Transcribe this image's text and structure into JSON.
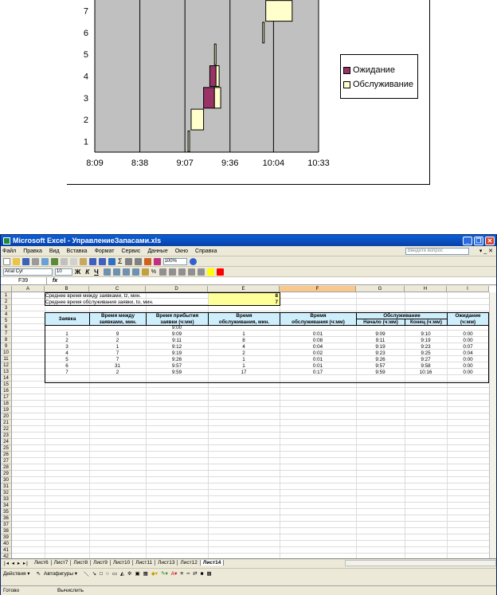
{
  "chart_data": {
    "type": "bar",
    "subtype": "stacked-horizontal-gantt",
    "x_tick_labels": [
      "8:09",
      "8:38",
      "9:07",
      "9:36",
      "10:04",
      "10:33"
    ],
    "y_tick_labels": [
      "1",
      "2",
      "3",
      "4",
      "5",
      "6",
      "7"
    ],
    "xlim": [
      "8:09",
      "10:33"
    ],
    "ylim": [
      0.5,
      7.5
    ],
    "categories": [
      1,
      2,
      3,
      4,
      5,
      6,
      7
    ],
    "series": [
      {
        "name": "Ожидание",
        "color": "#993366",
        "start": [
          "9:09",
          "9:11",
          "9:19",
          "9:23",
          "9:26",
          "9:57",
          "9:59"
        ],
        "duration_min": [
          0,
          0,
          7,
          4,
          0,
          0,
          0
        ]
      },
      {
        "name": "Обслуживание",
        "color": "#ffffcc",
        "start": [
          "9:09",
          "9:11",
          "9:19",
          "9:23",
          "9:26",
          "9:57",
          "9:59"
        ],
        "duration_min": [
          1,
          8,
          4,
          2,
          1,
          1,
          17
        ]
      }
    ],
    "grid": true,
    "plot_background": "#c0c0c0",
    "legend_position": "right"
  },
  "excel": {
    "title": "Microsoft Excel - УправлениеЗапасами.xls",
    "menu": [
      "Файл",
      "Правка",
      "Вид",
      "Вставка",
      "Формат",
      "Сервис",
      "Данные",
      "Окно",
      "Справка"
    ],
    "ask_placeholder": "Введите вопрос",
    "font_name": "Arial Cyr",
    "font_size": "10",
    "zoom": "100%",
    "name_box": "F39",
    "fx": "fx",
    "columns": [
      "A",
      "B",
      "C",
      "D",
      "E",
      "F",
      "G",
      "H",
      "I"
    ],
    "selected_column": "F",
    "params": {
      "tz_label": "Среднее время между заявками, tz, мин.",
      "tz_value": "8",
      "to_label": "Среднее время обслуживания заявки, to, мин.",
      "to_value": "7"
    },
    "headers": {
      "req": "Заявка",
      "interval_1": "Время между",
      "interval_2": "заявками, мин.",
      "arrival_1": "Время прибытия",
      "arrival_2": "заявки (ч:мм)",
      "svc_min_1": "Время",
      "svc_min_2": "обслуживания, мин.",
      "svc_hm_1": "Время",
      "svc_hm_2": "обслуживания (ч:мм)",
      "service_group": "Обслуживание",
      "start": "Начало (ч:мм)",
      "end": "Конец (ч:мм)",
      "wait_1": "Ожидание",
      "wait_2": "(ч:мм)"
    },
    "row7_arrival": "9:00",
    "rows": [
      {
        "n": "1",
        "dt": "9",
        "arr": "9:09",
        "svc": "1",
        "svc_hm": "0:01",
        "start": "9:09",
        "end": "9:10",
        "wait": "0:00"
      },
      {
        "n": "2",
        "dt": "2",
        "arr": "9:11",
        "svc": "8",
        "svc_hm": "0:08",
        "start": "9:11",
        "end": "9:19",
        "wait": "0:00"
      },
      {
        "n": "3",
        "dt": "1",
        "arr": "9:12",
        "svc": "4",
        "svc_hm": "0:04",
        "start": "9:19",
        "end": "9:23",
        "wait": "0:07"
      },
      {
        "n": "4",
        "dt": "7",
        "arr": "9:19",
        "svc": "2",
        "svc_hm": "0:02",
        "start": "9:23",
        "end": "9:25",
        "wait": "0:04"
      },
      {
        "n": "5",
        "dt": "7",
        "arr": "9:26",
        "svc": "1",
        "svc_hm": "0:01",
        "start": "9:26",
        "end": "9:27",
        "wait": "0:00"
      },
      {
        "n": "6",
        "dt": "31",
        "arr": "9:57",
        "svc": "1",
        "svc_hm": "0:01",
        "start": "9:57",
        "end": "9:58",
        "wait": "0:00"
      },
      {
        "n": "7",
        "dt": "2",
        "arr": "9:59",
        "svc": "17",
        "svc_hm": "0:17",
        "start": "9:59",
        "end": "10:16",
        "wait": "0:00"
      }
    ],
    "sheet_tabs": [
      "Лист6",
      "Лист7",
      "Лист8",
      "Лист9",
      "Лист10",
      "Лист11",
      "Лист13",
      "Лист12",
      "Лист14"
    ],
    "active_tab": "Лист14",
    "draw_actions": "Действия ▾",
    "autoshapes": "Автофигуры ▾",
    "status_ready": "Готово",
    "status_calc": "Вычислить"
  }
}
